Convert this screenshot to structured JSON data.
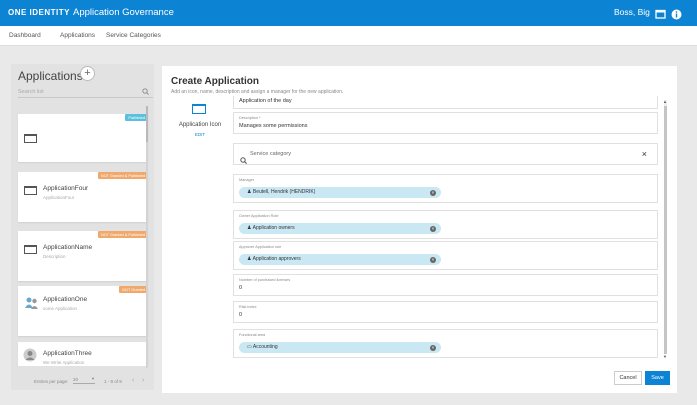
{
  "header": {
    "logo_text": "ONE IDENTITY",
    "app_title": "Application Governance",
    "user_name": "Boss, Big",
    "icons": [
      "screen-icon",
      "info-icon"
    ]
  },
  "nav": {
    "items": [
      "Dashboard",
      "Applications",
      "Service Categories"
    ]
  },
  "applications_panel": {
    "title": "Applications",
    "add_icon": "plus-icon",
    "search_placeholder": "Search list",
    "cards": [
      {
        "name": "",
        "desc": "",
        "badge": "Published",
        "badge_color": "#5bc0de"
      },
      {
        "name": "ApplicationFour",
        "desc": "ApplicationFour",
        "badge": "NOT Granted & Published",
        "badge_color": "#f0a86b"
      },
      {
        "name": "ApplicationName",
        "desc": "Description",
        "badge": "NOT Granted & Published",
        "badge_color": "#f0a86b"
      },
      {
        "name": "ApplicationOne",
        "desc": "some Application",
        "badge": "NOT Granted",
        "badge_color": "#f0a86b"
      },
      {
        "name": "ApplicationThree",
        "desc": "We Write Application",
        "badge": "",
        "badge_color": ""
      }
    ],
    "footer": {
      "entries_label": "Entries per page:",
      "entries_value": "20",
      "range": "1 - 9 of 9"
    }
  },
  "create_application": {
    "title": "Create Application",
    "subtitle": "Add an icon, name, description and assign a manager for the new application.",
    "icon_label": "Application Icon",
    "icon_edit": "EDIT",
    "name_value": "Application of the day",
    "description_label": "Description *",
    "description_value": "Manages some permissions",
    "service_category_placeholder": "Service category",
    "manager_label": "Manager",
    "manager_value": "Beutell, Hendrik (HENDRIK)",
    "owner_role_label": "Owner Application Role",
    "owner_role_value": "Application owners",
    "approver_role_label": "Approver Application role",
    "approver_role_value": "Application approvers",
    "licenses_label": "Number of purchased licenses",
    "licenses_value": "0",
    "risk_label": "Risk index",
    "risk_value": "0",
    "functional_area_label": "Functional area",
    "functional_area_value": "Accounting",
    "cancel_label": "Cancel",
    "save_label": "Save"
  },
  "colors": {
    "accent": "#0d83d4",
    "chip": "#c9e8f3",
    "badge_published": "#5bc0de",
    "badge_not_granted": "#f0a86b"
  }
}
